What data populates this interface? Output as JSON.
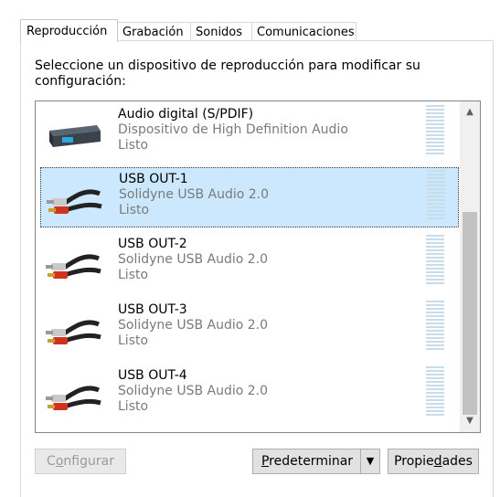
{
  "tabs": [
    {
      "label": "Reproducción",
      "active": true
    },
    {
      "label": "Grabación",
      "active": false
    },
    {
      "label": "Sonidos",
      "active": false
    },
    {
      "label": "Comunicaciones",
      "active": false
    }
  ],
  "instruction": "Seleccione un dispositivo de reproducción para modificar su configuración:",
  "devices": [
    {
      "name": "Audio digital (S/PDIF)",
      "description": "Dispositivo de High Definition Audio",
      "status": "Listo",
      "icon": "spdif-device-icon",
      "selected": false
    },
    {
      "name": "USB OUT-1",
      "description": "Solidyne USB Audio 2.0",
      "status": "Listo",
      "icon": "rca-cable-icon",
      "selected": true
    },
    {
      "name": "USB OUT-2",
      "description": "Solidyne USB Audio 2.0",
      "status": "Listo",
      "icon": "rca-cable-icon",
      "selected": false
    },
    {
      "name": "USB OUT-3",
      "description": "Solidyne USB Audio 2.0",
      "status": "Listo",
      "icon": "rca-cable-icon",
      "selected": false
    },
    {
      "name": "USB OUT-4",
      "description": "Solidyne USB Audio 2.0",
      "status": "Listo",
      "icon": "rca-cable-icon",
      "selected": false
    }
  ],
  "buttons": {
    "configure": {
      "pre": "C",
      "accel": "o",
      "post": "nfigurar",
      "enabled": false
    },
    "set_default": {
      "pre": "",
      "accel": "P",
      "post": "redeterminar",
      "enabled": true
    },
    "properties": {
      "pre": "Propie",
      "accel": "d",
      "post": "ades",
      "enabled": true
    }
  },
  "colors": {
    "selection": "#cce8ff",
    "meter": "#c8dde9",
    "secondary_text": "#7a7a7a"
  }
}
